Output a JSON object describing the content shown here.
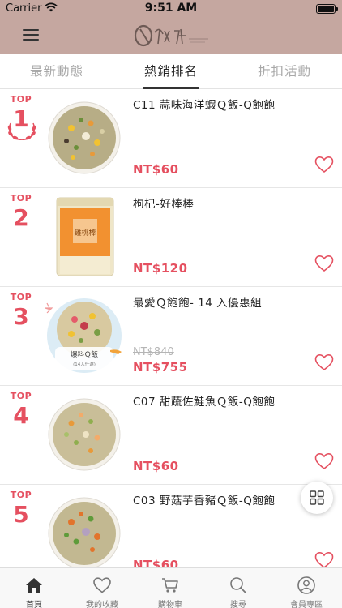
{
  "status_bar": {
    "carrier": "Carrier",
    "time": "9:51 AM"
  },
  "header": {
    "menu_icon": "hamburger-icon",
    "logo_icon": "brand-logo"
  },
  "tabs": [
    {
      "label": "最新動態",
      "active": false
    },
    {
      "label": "熱銷排名",
      "active": true
    },
    {
      "label": "折扣活動",
      "active": false
    }
  ],
  "products": [
    {
      "rank_prefix": "TOP",
      "rank": "1",
      "name": "C11 蒜味海洋蝦Ｑ飯-Q飽飽",
      "old_price": "",
      "price": "NT$60"
    },
    {
      "rank_prefix": "TOP",
      "rank": "2",
      "name": "枸杞-好棒棒",
      "old_price": "",
      "price": "NT$120"
    },
    {
      "rank_prefix": "TOP",
      "rank": "3",
      "name": "最愛Ｑ飽飽- 14 入優惠組",
      "old_price": "NT$840",
      "price": "NT$755",
      "thumb_caption": "爆料Ｑ飯",
      "thumb_subcaption": "(14入任選)"
    },
    {
      "rank_prefix": "TOP",
      "rank": "4",
      "name": "C07 甜蔬佐鮭魚Ｑ飯-Q飽飽",
      "old_price": "",
      "price": "NT$60"
    },
    {
      "rank_prefix": "TOP",
      "rank": "5",
      "name": "C03 野菇芋香豬Ｑ飯-Q飽飽",
      "old_price": "",
      "price": "NT$60"
    }
  ],
  "thumb2_label": "雞桃棒",
  "bottom_nav": [
    {
      "label": "首頁",
      "icon": "home-icon",
      "active": true
    },
    {
      "label": "我的收藏",
      "icon": "heart-icon",
      "active": false
    },
    {
      "label": "購物車",
      "icon": "cart-icon",
      "active": false
    },
    {
      "label": "搜尋",
      "icon": "search-icon",
      "active": false
    },
    {
      "label": "會員專區",
      "icon": "user-icon",
      "active": false
    }
  ],
  "colors": {
    "header": "#c5a7a0",
    "accent": "#e55060"
  }
}
